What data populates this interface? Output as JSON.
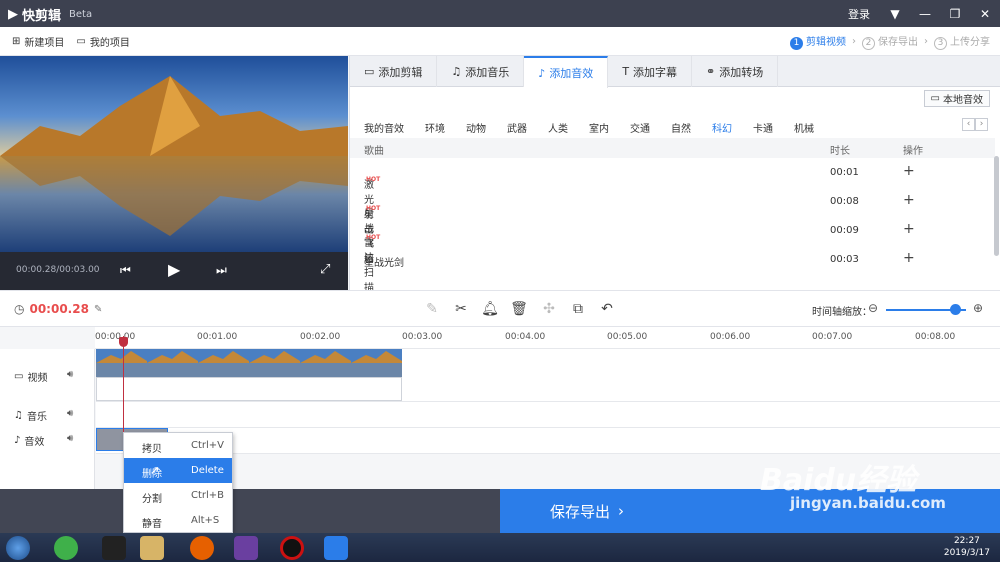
{
  "app": {
    "name": "快剪辑",
    "badge": "Beta"
  },
  "window": {
    "login": "登录"
  },
  "menu": {
    "new_project": "新建项目",
    "my_projects": "我的项目"
  },
  "steps": [
    {
      "num": "1",
      "label": "剪辑视频",
      "active": true
    },
    {
      "num": "2",
      "label": "保存导出",
      "active": false
    },
    {
      "num": "3",
      "label": "上传分享",
      "active": false
    }
  ],
  "preview": {
    "time": "00:00.28/00:03.00"
  },
  "tabs": [
    {
      "label": "添加剪辑",
      "icon": "video-icon"
    },
    {
      "label": "添加音乐",
      "icon": "music-icon"
    },
    {
      "label": "添加音效",
      "icon": "sound-effect-icon",
      "active": true
    },
    {
      "label": "添加字幕",
      "icon": "text-icon"
    },
    {
      "label": "添加转场",
      "icon": "transition-icon"
    }
  ],
  "local_sound": "本地音效",
  "categories": [
    "我的音效",
    "环境",
    "动物",
    "武器",
    "人类",
    "室内",
    "交通",
    "自然",
    "科幻",
    "卡通",
    "机械"
  ],
  "active_category": "科幻",
  "table": {
    "headers": {
      "name": "歌曲",
      "duration": "时长",
      "action": "操作"
    },
    "rows": [
      {
        "name": "激光射击",
        "duration": "00:01",
        "hot": true
      },
      {
        "name": "星战飞船",
        "duration": "00:08",
        "hot": true
      },
      {
        "name": "雷达扫描",
        "duration": "00:09",
        "hot": true
      },
      {
        "name": "星战光剑",
        "duration": "00:03",
        "hot": false
      }
    ],
    "hot_label": "HOT"
  },
  "editor": {
    "current_time": "00:00.28",
    "zoom_label": "时间轴缩放："
  },
  "ruler": [
    "00:00.00",
    "00:01.00",
    "00:02.00",
    "00:03.00",
    "00:04.00",
    "00:05.00",
    "00:06.00",
    "00:07.00",
    "00:08.00"
  ],
  "tracks": {
    "video": "视频",
    "music": "音乐",
    "effect": "音效"
  },
  "context_menu": [
    {
      "label": "拷贝",
      "key": "Ctrl+V"
    },
    {
      "label": "删除",
      "key": "Delete",
      "highlighted": true
    },
    {
      "label": "分割",
      "key": "Ctrl+B"
    },
    {
      "label": "静音",
      "key": "Alt+S"
    }
  ],
  "export": {
    "label": "保存导出",
    "arrow": "›"
  },
  "taskbar": {
    "time": "22:27",
    "date": "2019/3/17"
  },
  "watermark": {
    "brand": "Baidu经验",
    "url": "jingyan.baidu.com"
  },
  "colors": {
    "accent": "#2b7de9",
    "danger": "#e84d4d",
    "titlebar": "#3d4150"
  }
}
